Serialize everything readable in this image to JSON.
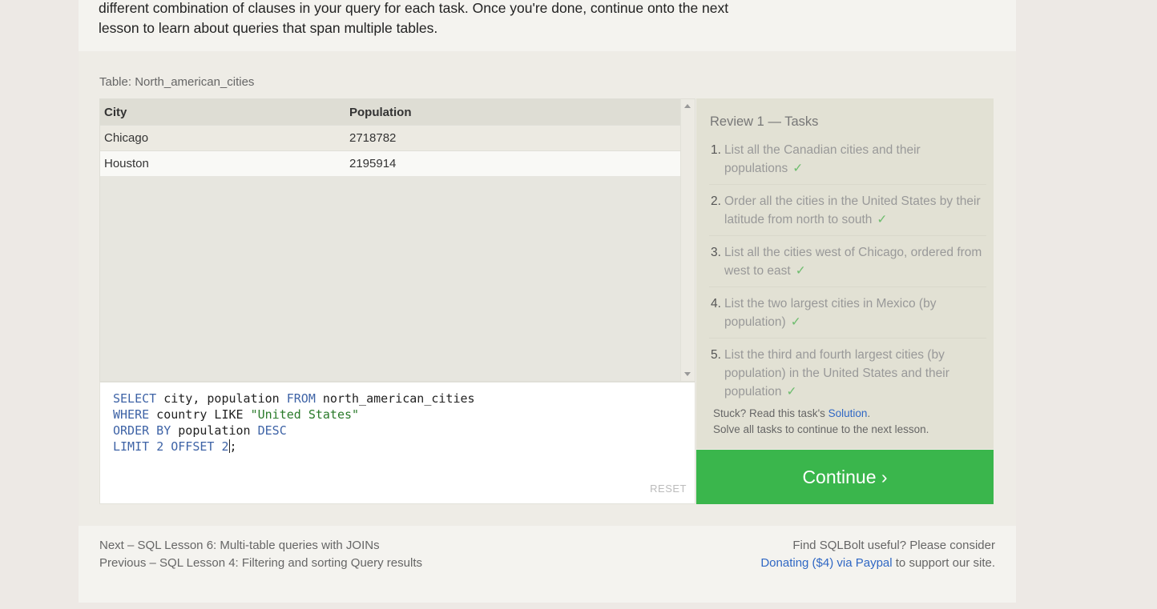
{
  "intro": {
    "line1": "different combination of clauses in your query for each task. Once you're done, continue onto the next",
    "line2": "lesson to learn about queries that span multiple tables."
  },
  "table": {
    "label": "Table: North_american_cities",
    "columns": [
      "City",
      "Population"
    ],
    "rows": [
      [
        "Chicago",
        "2718782"
      ],
      [
        "Houston",
        "2195914"
      ]
    ]
  },
  "editor": {
    "lines": [
      [
        [
          "kw",
          "SELECT"
        ],
        [
          "plain",
          " city, population "
        ],
        [
          "kw",
          "FROM"
        ],
        [
          "plain",
          " north_american_cities"
        ]
      ],
      [
        [
          "kw",
          "WHERE"
        ],
        [
          "plain",
          " country LIKE "
        ],
        [
          "str",
          "\"United States\""
        ]
      ],
      [
        [
          "kw",
          "ORDER BY"
        ],
        [
          "plain",
          " population "
        ],
        [
          "kw",
          "DESC"
        ]
      ],
      [
        [
          "kw",
          "LIMIT"
        ],
        [
          "plain",
          " "
        ],
        [
          "num",
          "2"
        ],
        [
          "plain",
          " "
        ],
        [
          "kw",
          "OFFSET"
        ],
        [
          "plain",
          " "
        ],
        [
          "num",
          "2"
        ],
        [
          "cursor",
          ""
        ],
        [
          "plain",
          ";"
        ]
      ]
    ],
    "reset_label": "RESET"
  },
  "tasks": {
    "title": "Review 1 — Tasks",
    "check": "✓",
    "items": [
      "List all the Canadian cities and their populations",
      "Order all the cities in the United States by their latitude from north to south",
      "List all the cities west of Chicago, ordered from west to east",
      "List the two largest cities in Mexico (by population)",
      "List the third and fourth largest cities (by population) in the United States and their population"
    ],
    "stuck_prefix": "Stuck? Read this task's ",
    "solution_link": "Solution",
    "stuck_suffix": ".",
    "solve_all": "Solve all tasks to continue to the next lesson."
  },
  "continue_label": "Continue ›",
  "footer": {
    "next_prefix": "Next – ",
    "next_link": "SQL Lesson 6: Multi-table queries with JOINs",
    "prev_prefix": "Previous – ",
    "prev_link": "SQL Lesson 4: Filtering and sorting Query results",
    "donate_line1": "Find SQLBolt useful? Please consider",
    "donate_link": "Donating ($4) via Paypal",
    "donate_suffix": " to support our site."
  },
  "colors": {
    "continue_bg": "#3ab64c",
    "link": "#2f67c4",
    "keyword": "#3e63a6"
  }
}
